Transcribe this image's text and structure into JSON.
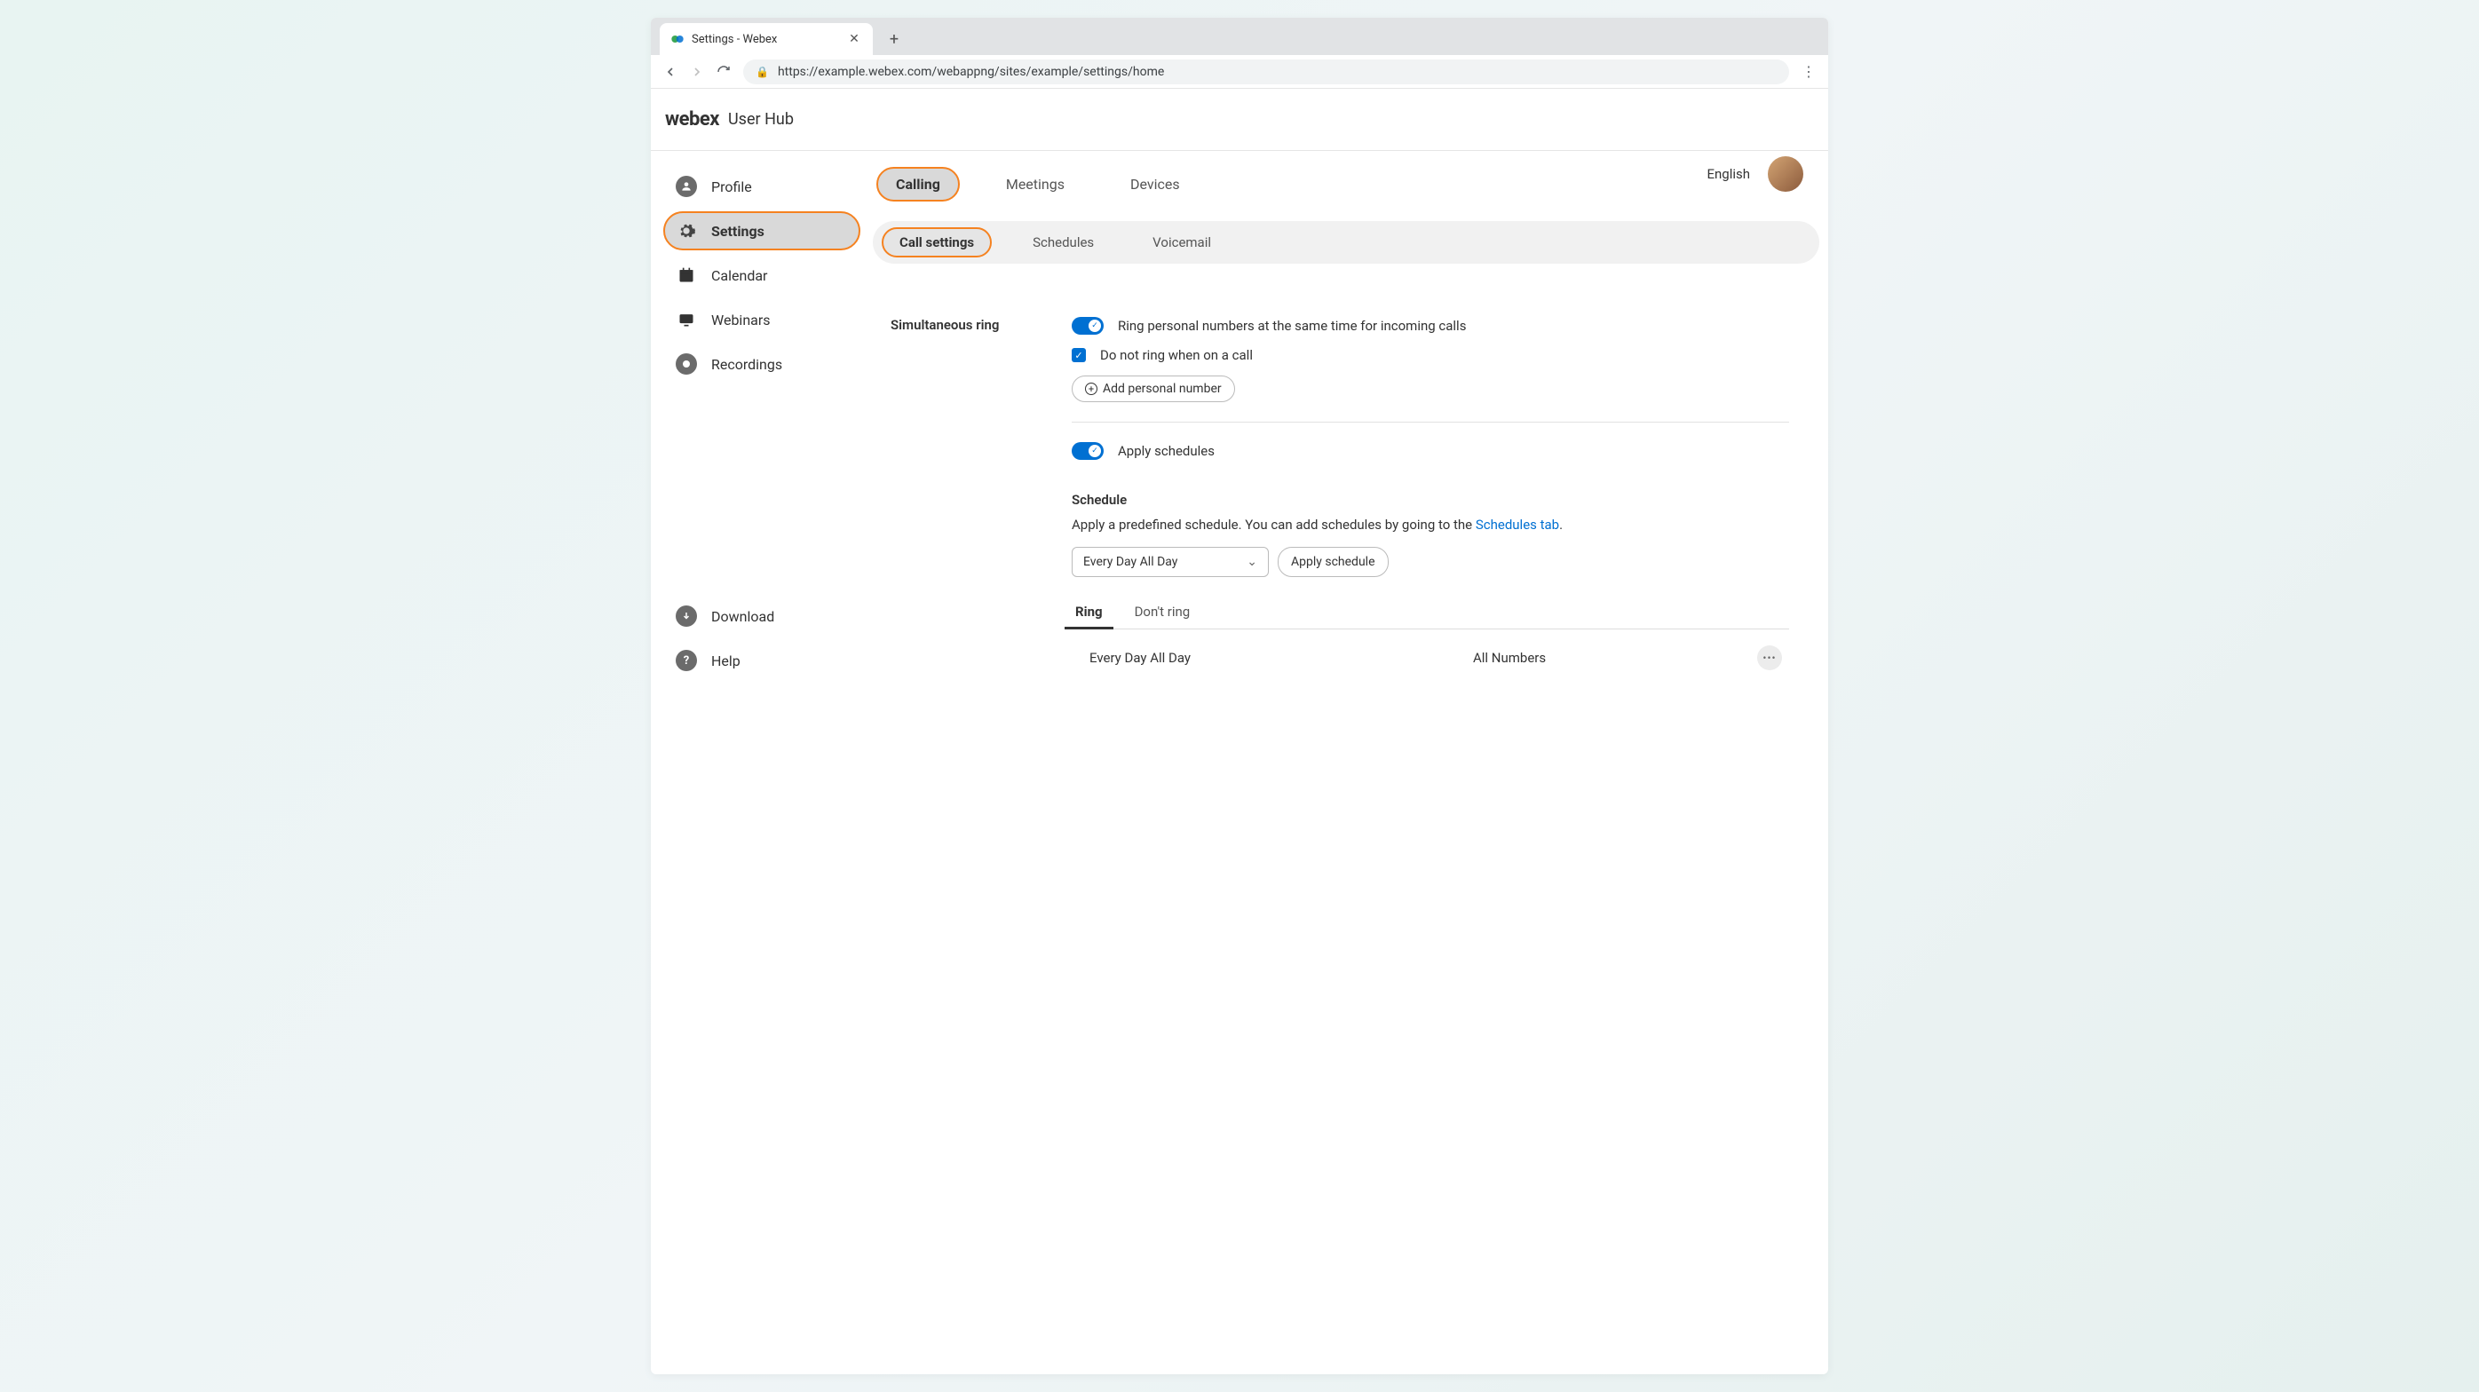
{
  "browser": {
    "tab_title": "Settings - Webex",
    "url": "https://example.webex.com/webappng/sites/example/settings/home"
  },
  "header": {
    "logo": "webex",
    "title": "User Hub"
  },
  "top_right": {
    "language": "English"
  },
  "sidebar": {
    "items": [
      {
        "label": "Profile"
      },
      {
        "label": "Settings"
      },
      {
        "label": "Calendar"
      },
      {
        "label": "Webinars"
      },
      {
        "label": "Recordings"
      }
    ],
    "footer": [
      {
        "label": "Download"
      },
      {
        "label": "Help"
      }
    ]
  },
  "tabs": {
    "primary": [
      {
        "label": "Calling"
      },
      {
        "label": "Meetings"
      },
      {
        "label": "Devices"
      }
    ],
    "secondary": [
      {
        "label": "Call settings"
      },
      {
        "label": "Schedules"
      },
      {
        "label": "Voicemail"
      }
    ]
  },
  "simring": {
    "section_label": "Simultaneous ring",
    "ring_desc": "Ring personal numbers at the same time for incoming calls",
    "do_not_ring": "Do not ring when on a call",
    "add_btn": "Add personal number",
    "apply_schedules": "Apply schedules",
    "schedule_heading": "Schedule",
    "schedule_desc_prefix": "Apply a predefined schedule. You can add schedules by going to the ",
    "schedule_link": "Schedules tab",
    "schedule_desc_suffix": ".",
    "select_value": "Every Day All Day",
    "apply_btn": "Apply schedule",
    "inner_tabs": [
      {
        "label": "Ring"
      },
      {
        "label": "Don't ring"
      }
    ],
    "rows": [
      {
        "schedule": "Every Day All Day",
        "numbers": "All Numbers"
      }
    ]
  }
}
